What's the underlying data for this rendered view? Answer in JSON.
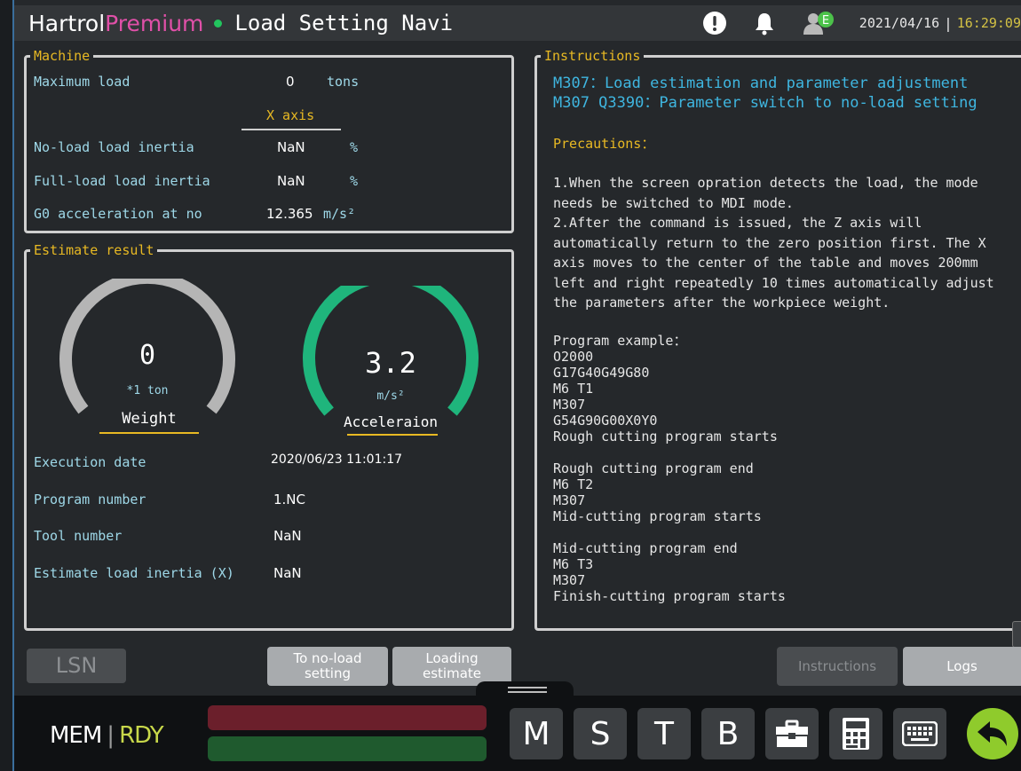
{
  "titlebar": {
    "brand_main": "Hartrol",
    "brand_accent": "Premium",
    "title": "Load Setting Navi",
    "date": "2021/04/16",
    "time": "16:29:09",
    "icons": [
      "alert-icon",
      "bell-icon",
      "user-status-icon"
    ],
    "user_badge": "E"
  },
  "machine": {
    "title": "Machine",
    "max_load_label": "Maximum load",
    "max_load_value": "0",
    "max_load_unit": "tons",
    "axis_header": "X axis",
    "rows": [
      {
        "label": "No-load load inertia",
        "value": "NaN",
        "unit": "%"
      },
      {
        "label": "Full-load load inertia",
        "value": "NaN",
        "unit": "%"
      },
      {
        "label": "G0 acceleration at no",
        "value": "12.365",
        "unit": "m/s²"
      }
    ]
  },
  "estimate": {
    "title": "Estimate result",
    "weight": {
      "value": "0",
      "unit": "*1 ton",
      "label": "Weight",
      "fill": 0,
      "color": "#b5b5b5"
    },
    "accel": {
      "value": "3.2",
      "unit": "m/s²",
      "label": "Acceleraion",
      "fill": 1,
      "color": "#1fb57c"
    },
    "rows": [
      {
        "label": "Execution date",
        "value": "2020/06/23 11:01:17"
      },
      {
        "label": "Program number",
        "value": "1.NC"
      },
      {
        "label": "Tool number",
        "value": "NaN"
      },
      {
        "label": "Estimate load inertia (X)",
        "value": "NaN"
      }
    ]
  },
  "instructions": {
    "title": "Instructions",
    "line1": "M307：Load estimation and parameter adjustment",
    "line2": "M307 Q3390：Parameter switch to no-load setting",
    "precautions": "Precautions：",
    "body": "1.When the screen opration detects the load, the mode\nneeds be switched to MDI mode.\n2.After the command is issued, the Z axis will\nautomatically return to the zero position first. The X\naxis moves to the center of the table and moves 200mm\nleft and right repeatedly 10 times automatically adjust\nthe parameters after the workpiece weight.",
    "program_label": "Program example：",
    "program1": "O2000\nG17G40G49G80\nM6 T1\nM307\nG54G90G00X0Y0\nRough cutting program starts",
    "program2": "Rough cutting program end\nM6 T2\nM307\nMid-cutting program starts",
    "program3": "Mid-cutting program end\nM6 T3\nM307\nFinish-cutting program starts"
  },
  "buttons": {
    "lsn": "LSN",
    "to_noload_1": "To no-load",
    "to_noload_2": "setting",
    "loading_1": "Loading",
    "loading_2": "estimate",
    "instructions": "Instructions",
    "logs": "Logs"
  },
  "status": {
    "mode": "MEM",
    "state": "RDY"
  },
  "keys": [
    "M",
    "S",
    "T",
    "B"
  ]
}
